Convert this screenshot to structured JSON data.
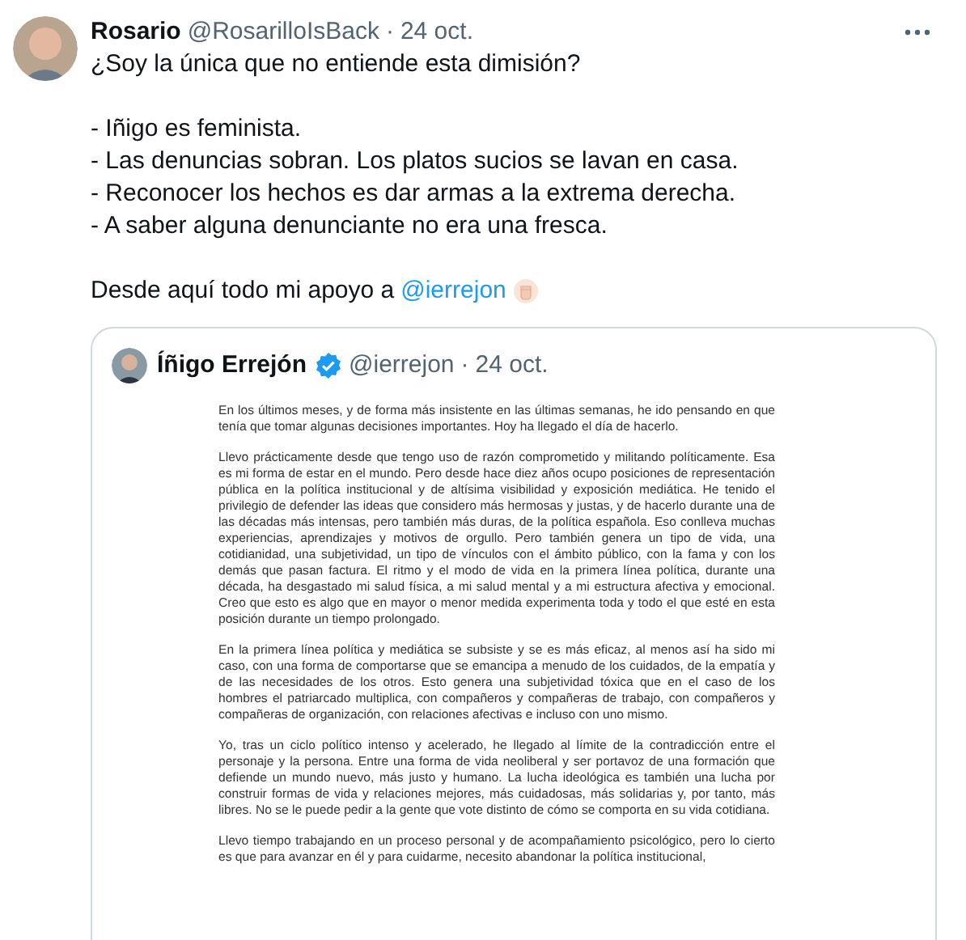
{
  "tweet": {
    "name": "Rosario",
    "handle": "@RosarilloIsBack",
    "separator": "·",
    "date": "24 oct.",
    "question": "¿Soy la única que no entiende esta dimisión?",
    "lines": [
      "- Iñigo es feminista.",
      "- Las denuncias sobran. Los platos sucios se lavan en casa.",
      "- Reconocer los hechos es dar armas a la extrema derecha.",
      "- A saber alguna denunciante no era una fresca."
    ],
    "closing": {
      "text": "Desde aquí todo mi apoyo a",
      "mention": "@ierrejon"
    }
  },
  "quote": {
    "name": "Íñigo Errejón",
    "verified": true,
    "handle": "@ierrejon",
    "separator": "·",
    "date": "24 oct.",
    "document": [
      "En los últimos meses, y de forma más insistente en las últimas semanas, he ido pensando en que tenía que tomar algunas decisiones importantes. Hoy ha llegado el día de hacerlo.",
      "Llevo prácticamente desde que tengo uso de razón comprometido y militando políticamente. Esa es mi forma de estar en el mundo. Pero desde hace diez años ocupo posiciones de representación pública en la política institucional y de altísima visibilidad y exposición mediática. He tenido el privilegio de defender las ideas que considero más hermosas y justas, y de hacerlo durante una de las décadas más intensas, pero también más duras, de la política española. Eso conlleva muchas experiencias, aprendizajes y motivos de orgullo. Pero también genera un tipo de vida, una cotidianidad, una subjetividad, un tipo de vínculos con el ámbito público, con la fama y con los demás que pasan factura. El ritmo y el modo de vida en la primera línea política, durante una década, ha desgastado mi salud física, a mi salud mental y a mi estructura afectiva y emocional. Creo que esto es algo que en mayor o menor medida experimenta toda y todo el que esté en esta posición durante un tiempo prolongado.",
      "En la primera línea política y mediática se subsiste y se es más eficaz, al menos así ha sido mi caso, con una forma de comportarse que se emancipa a menudo de los cuidados, de la empatía y de las necesidades de los otros. Esto genera una subjetividad tóxica que en el caso de los hombres el patriarcado multiplica, con compañeros y compañeras de trabajo, con compañeros y compañeras de organización, con relaciones afectivas e incluso con uno mismo.",
      "Yo, tras un ciclo político intenso y acelerado, he llegado al límite de la contradicción entre el personaje y la persona. Entre una forma de vida neoliberal y ser portavoz de una formación que defiende un mundo nuevo, más justo y humano. La lucha ideológica es también una lucha por construir formas de vida y relaciones mejores, más cuidadosas, más solidarias y, por tanto, más libres. No se le puede pedir a la gente que vote distinto de cómo se comporta en su vida cotidiana.",
      "Llevo tiempo trabajando en un proceso personal y de acompañamiento psicológico, pero lo cierto es que para avanzar en él y para cuidarme, necesito abandonar la política institucional,"
    ]
  }
}
